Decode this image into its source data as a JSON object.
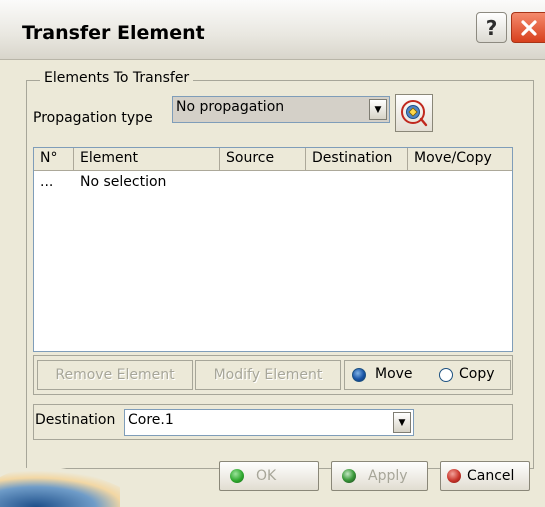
{
  "window": {
    "title": "Transfer Element",
    "help_label": "?"
  },
  "group": {
    "legend": "Elements To Transfer"
  },
  "propagation": {
    "label": "Propagation type",
    "selected": "No propagation"
  },
  "table": {
    "columns": [
      "N°",
      "Element",
      "Source",
      "Destination",
      "Move/Copy"
    ],
    "rows": [
      {
        "number": "...",
        "element": "No selection"
      }
    ]
  },
  "actions": {
    "remove_label": "Remove Element",
    "modify_label": "Modify Element"
  },
  "mode": {
    "move_label": "Move",
    "copy_label": "Copy",
    "selected": "Move"
  },
  "destination": {
    "label": "Destination",
    "value": "Core.1"
  },
  "footer": {
    "ok_label": "OK",
    "apply_label": "Apply",
    "cancel_label": "Cancel"
  },
  "colors": {
    "ok_dot": "#2fa82f",
    "apply_dot": "#3a9a3a",
    "cancel_dot": "#c8342a",
    "radio_checked": "#1a56a8"
  }
}
